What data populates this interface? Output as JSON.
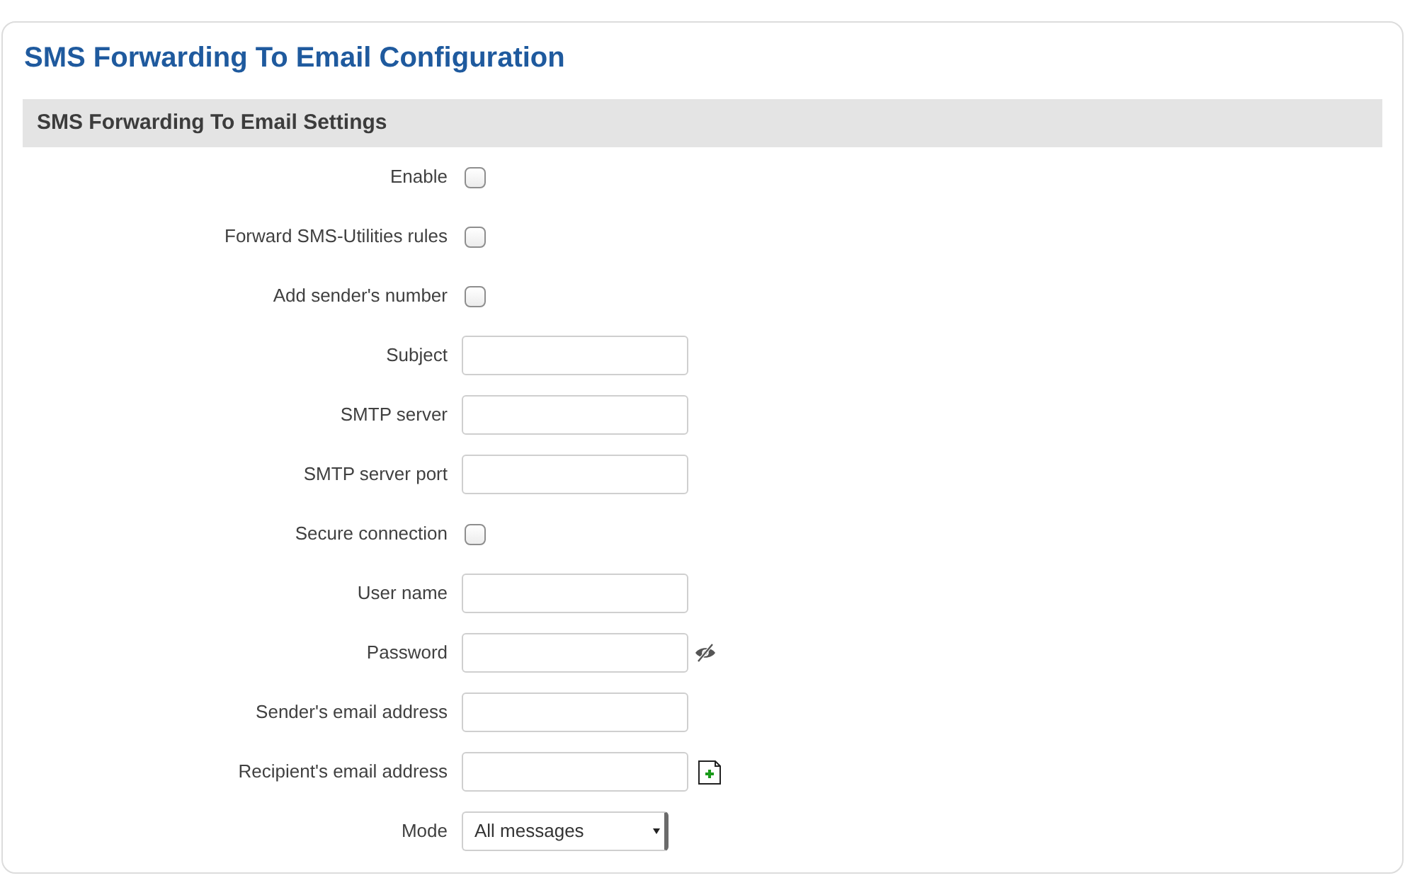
{
  "page": {
    "title": "SMS Forwarding To Email Configuration"
  },
  "section": {
    "title": "SMS Forwarding To Email Settings"
  },
  "fields": [
    {
      "kind": "checkbox",
      "label": "Enable",
      "checked": false
    },
    {
      "kind": "checkbox",
      "label": "Forward SMS-Utilities rules",
      "checked": false
    },
    {
      "kind": "checkbox",
      "label": "Add sender's number",
      "checked": false
    },
    {
      "kind": "text",
      "label": "Subject"
    },
    {
      "kind": "text",
      "label": "SMTP server"
    },
    {
      "kind": "text",
      "label": "SMTP server port"
    },
    {
      "kind": "checkbox",
      "label": "Secure connection",
      "checked": false
    },
    {
      "kind": "text",
      "label": "User name"
    },
    {
      "kind": "password",
      "label": "Password"
    },
    {
      "kind": "text",
      "label": "Sender's email address"
    },
    {
      "kind": "list",
      "label": "Recipient's email address"
    },
    {
      "kind": "select",
      "label": "Mode",
      "value": "All messages"
    }
  ]
}
